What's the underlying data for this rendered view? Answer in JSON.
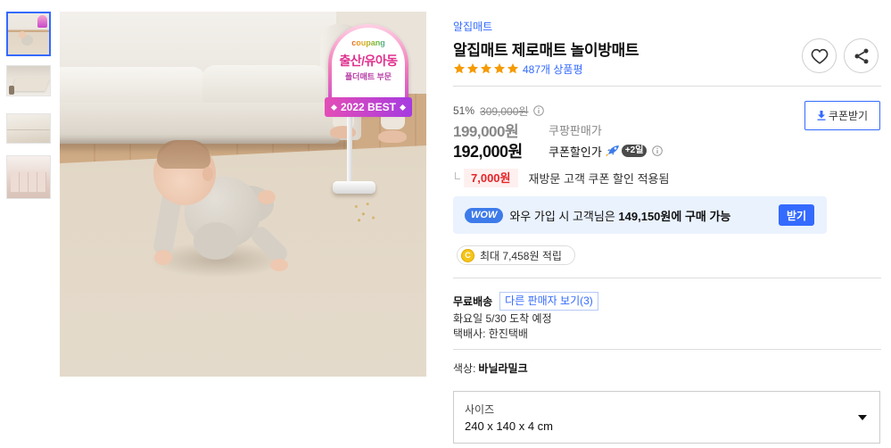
{
  "colors": {
    "accent": "#346aff",
    "wow_bg": "#eaf2fe",
    "price_red": "#e52528",
    "star": "#f59a00",
    "divider": "#dddddd"
  },
  "gallery": {
    "selected_thumbnail": 1
  },
  "image_badge": {
    "logo": "coupang",
    "category": "출산/유아동",
    "section": "폴더매트 부문",
    "award": "2022 BEST"
  },
  "product": {
    "brand": "알집매트",
    "title": "알집매트 제로매트 놀이방매트",
    "rating": 5,
    "review_count": "487개 상품평"
  },
  "price": {
    "discount_rate": "51%",
    "original_price": "309,000원",
    "sale_price": "199,000원",
    "sale_label": "쿠팡판매가",
    "coupon_price": "192,000원",
    "coupon_label": "쿠폰할인가",
    "delivery_badge": "+2일"
  },
  "coupon_button": {
    "label": "쿠폰받기"
  },
  "revisit_coupon": {
    "amount": "7,000원",
    "text": "재방문 고객 쿠폰 할인 적용됨"
  },
  "wow": {
    "badge": "WOW",
    "text": "와우 가입 시 고객님은 ",
    "highlight": "149,150원에 구매 가능",
    "button": "받기"
  },
  "reward": {
    "coin_symbol": "C",
    "text": "최대 7,458원 적립"
  },
  "shipping": {
    "type": "무료배송",
    "other_sellers": "다른 판매자 보기(3)",
    "arrival": "화요일 5/30 도착 예정",
    "carrier": "택배사: 한진택배"
  },
  "options": {
    "color_label": "색상:",
    "color_value": "바닐라밀크",
    "size_label": "사이즈",
    "size_value": "240 x 140 x 4 cm"
  },
  "icons": {
    "favorite": "heart-icon",
    "share": "share-icon",
    "info": "info-icon",
    "rocket": "rocket-icon",
    "download": "download-icon",
    "coin": "coin-icon",
    "dropdown": "chevron-down-icon",
    "rating": "star-icon"
  }
}
